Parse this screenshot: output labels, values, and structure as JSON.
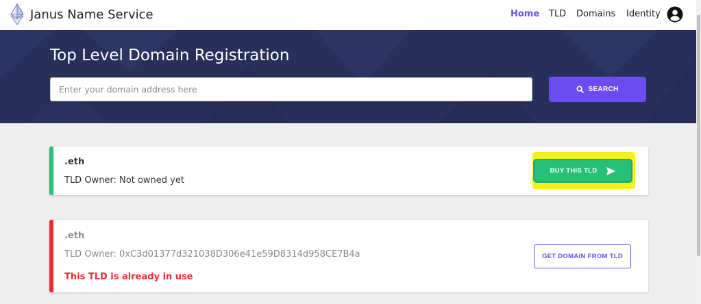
{
  "header": {
    "brand": "Janus Name Service",
    "nav": [
      "Home",
      "TLD",
      "Domains",
      "Identity"
    ]
  },
  "hero": {
    "title": "Top Level Domain Registration",
    "search_placeholder": "Enter your domain address here",
    "search_label": "SEARCH"
  },
  "results": [
    {
      "name": ".eth",
      "owner": "TLD Owner: Not owned yet",
      "action": "BUY THIS TLD"
    },
    {
      "name": ".eth",
      "owner": "TLD Owner: 0xC3d01377d321038D306e41e59D8314d958CE7B4a",
      "error": "This TLD is already in use",
      "action": "GET DOMAIN FROM TLD"
    }
  ],
  "colors": {
    "accent": "#6a4cf1",
    "success": "#26c07a",
    "danger": "#f02a32",
    "hero_bg": "#27305a",
    "highlight": "#f2f21a"
  },
  "icons": [
    "ethereum-logo-icon",
    "account-circle-icon",
    "search-icon",
    "send-arrow-icon"
  ]
}
